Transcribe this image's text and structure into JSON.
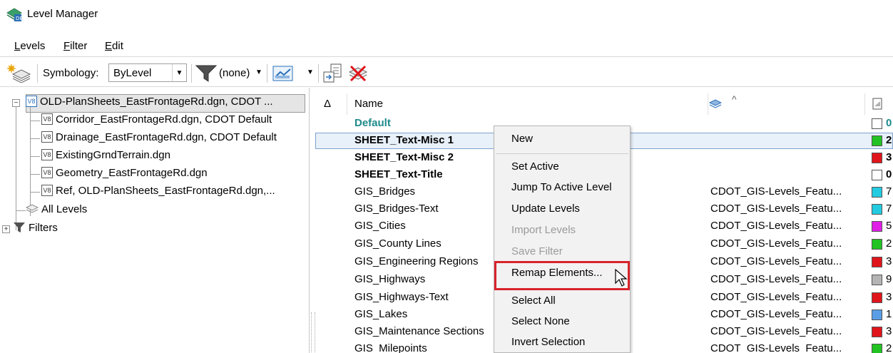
{
  "window": {
    "title": "Level Manager"
  },
  "menubar": [
    "Levels",
    "Filter",
    "Edit"
  ],
  "toolbar": {
    "symbology_label": "Symbology:",
    "symbology_value": "ByLevel",
    "filter_value": "(none)"
  },
  "tree": {
    "root": "OLD-PlanSheets_EastFrontageRd.dgn, CDOT ...",
    "children": [
      "Corridor_EastFrontageRd.dgn, CDOT Default",
      "Drainage_EastFrontageRd.dgn, CDOT Default",
      "ExistingGrndTerrain.dgn",
      "Geometry_EastFrontageRd.dgn",
      "Ref, OLD-PlanSheets_EastFrontageRd.dgn,..."
    ],
    "all_levels": "All Levels",
    "filters": "Filters"
  },
  "list": {
    "sort_glyph": "Δ",
    "name_header": "Name",
    "rows": [
      {
        "name": "Default",
        "file": "",
        "color": "#ffffff",
        "num": "0",
        "style": "default"
      },
      {
        "name": "SHEET_Text-Misc 1",
        "file": "",
        "color": "#22c322",
        "num": "2",
        "style": "bold"
      },
      {
        "name": "SHEET_Text-Misc 2",
        "file": "",
        "color": "#e0151b",
        "num": "3",
        "style": "bold"
      },
      {
        "name": "SHEET_Text-Title",
        "file": "",
        "color": "#ffffff",
        "num": "0",
        "style": "bold"
      },
      {
        "name": "GIS_Bridges",
        "file": "CDOT_GIS-Levels_Featu...",
        "color": "#22cbe0",
        "num": "7",
        "style": "normal"
      },
      {
        "name": "GIS_Bridges-Text",
        "file": "CDOT_GIS-Levels_Featu...",
        "color": "#22cbe0",
        "num": "7",
        "style": "normal"
      },
      {
        "name": "GIS_Cities",
        "file": "CDOT_GIS-Levels_Featu...",
        "color": "#e01ee6",
        "num": "5",
        "style": "normal"
      },
      {
        "name": "GIS_County Lines",
        "file": "CDOT_GIS-Levels_Featu...",
        "color": "#22c322",
        "num": "2",
        "style": "normal"
      },
      {
        "name": "GIS_Engineering Regions",
        "file": "CDOT_GIS-Levels_Featu...",
        "color": "#e0151b",
        "num": "3",
        "style": "normal"
      },
      {
        "name": "GIS_Highways",
        "file": "CDOT_GIS-Levels_Featu...",
        "color": "#b4b4b4",
        "num": "9",
        "style": "normal"
      },
      {
        "name": "GIS_Highways-Text",
        "file": "CDOT_GIS-Levels_Featu...",
        "color": "#e0151b",
        "num": "3",
        "style": "normal"
      },
      {
        "name": "GIS_Lakes",
        "file": "CDOT_GIS-Levels_Featu...",
        "color": "#5a9ee6",
        "num": "1",
        "style": "normal"
      },
      {
        "name": "GIS_Maintenance Sections",
        "file": "CDOT_GIS-Levels_Featu...",
        "color": "#e0151b",
        "num": "3",
        "style": "normal"
      },
      {
        "name": "GIS_Milepoints",
        "file": "CDOT_GIS-Levels_Featu...",
        "color": "#22c322",
        "num": "2",
        "style": "normal"
      }
    ]
  },
  "context_menu": {
    "items": [
      {
        "label": "New",
        "disabled": false
      },
      {
        "label": "Set Active",
        "disabled": false
      },
      {
        "label": "Jump To Active Level",
        "disabled": false
      },
      {
        "label": "Update Levels",
        "disabled": false
      },
      {
        "label": "Import Levels",
        "disabled": true
      },
      {
        "label": "Save Filter",
        "disabled": true
      },
      {
        "label": "Remap Elements...",
        "disabled": false
      },
      {
        "label": "Select All",
        "disabled": false
      },
      {
        "label": "Select None",
        "disabled": false
      },
      {
        "label": "Invert Selection",
        "disabled": false
      }
    ]
  },
  "colors": {
    "default_level": "#1e8a8a",
    "highlight_box": "#d9232c",
    "selection": "#e8f0f9"
  }
}
